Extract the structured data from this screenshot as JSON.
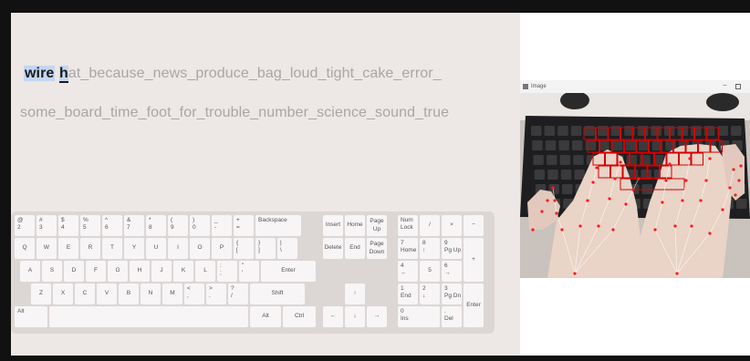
{
  "typing": {
    "line1_typed": "wire",
    "line1_space": " ",
    "line1_current": "h",
    "line1_rest": "at_because_news_produce_bag_loud_tight_cake_error_",
    "line2": "some_board_time_foot_for_trouble_number_science_sound_true"
  },
  "keyboard": {
    "row1": [
      "@\n2",
      "#\n3",
      "$\n4",
      "%\n5",
      "^\n6",
      "&\n7",
      "*\n8",
      "(\n9",
      ")\n0",
      "_\n-",
      "+\n=",
      "Backspace"
    ],
    "row2": [
      "Q",
      "W",
      "E",
      "R",
      "T",
      "Y",
      "U",
      "I",
      "O",
      "P",
      "{\n[",
      "}\n]",
      "|\n\\"
    ],
    "row3": [
      "A",
      "S",
      "D",
      "F",
      "G",
      "H",
      "J",
      "K",
      "L",
      ":\n;",
      "\"\n'",
      "Enter"
    ],
    "row4": [
      "Z",
      "X",
      "C",
      "V",
      "B",
      "N",
      "M",
      "<\n,",
      ">\n.",
      "?\n/",
      "Shift"
    ],
    "row5": [
      "Alt",
      "",
      "Alt",
      "Ctrl"
    ],
    "nav_top": [
      "Insert",
      "Home",
      "Page\nUp"
    ],
    "nav_mid": [
      "Delete",
      "End",
      "Page\nDown"
    ],
    "arrows": [
      "↑",
      "←",
      "↓",
      "→"
    ],
    "numpad": [
      [
        "Num\nLock",
        "/",
        "×",
        "−"
      ],
      [
        "7\nHome",
        "8\n↑",
        "9\nPg Up",
        "+"
      ],
      [
        "4\n←",
        "5",
        "6\n→"
      ],
      [
        "1\nEnd",
        "2\n↓",
        "3\nPg Dn",
        "Enter"
      ],
      [
        "0\nIns",
        ".\nDel"
      ]
    ]
  },
  "camera_window": {
    "title": "Image",
    "minimize": "−"
  },
  "colors": {
    "highlight": "#c4d6f2",
    "landmark": "#ff1a1a",
    "key_overlay": "#d40000"
  }
}
